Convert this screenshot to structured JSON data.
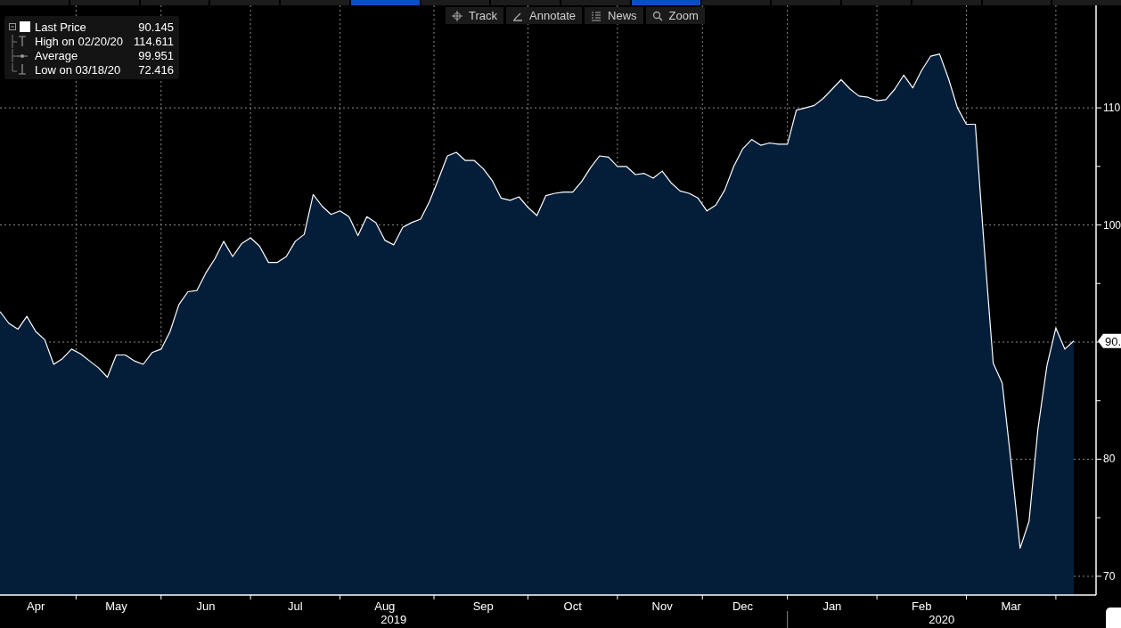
{
  "top_tabs": [
    {
      "selected": false
    },
    {
      "selected": false
    },
    {
      "selected": false
    },
    {
      "selected": false
    },
    {
      "selected": false
    },
    {
      "selected": true
    },
    {
      "selected": false
    },
    {
      "selected": false
    },
    {
      "selected": false
    },
    {
      "selected": true
    },
    {
      "selected": false
    },
    {
      "selected": false
    },
    {
      "selected": false
    },
    {
      "selected": false
    },
    {
      "selected": false
    },
    {
      "selected": false
    }
  ],
  "toolbar": [
    {
      "label": "Track",
      "kind": "track"
    },
    {
      "label": "Annotate",
      "kind": "annotate"
    },
    {
      "label": "News",
      "kind": "news"
    },
    {
      "label": "Zoom",
      "kind": "zoom"
    }
  ],
  "legend": {
    "items": [
      {
        "kind": "last",
        "value": "90.145"
      },
      {
        "kind": "high",
        "label": "High on 02/20/20",
        "value": "114.611"
      },
      {
        "kind": "average",
        "label": "Average",
        "value": "99.951"
      },
      {
        "kind": "low",
        "label": "Low on 03/18/20",
        "value": "72.416"
      }
    ]
  },
  "chart": {
    "chart_data": {
      "type": "area",
      "ylim": [
        68.4,
        118.6
      ],
      "yticks": [
        70,
        80,
        100,
        110
      ],
      "grid": true,
      "categories": [
        null,
        null,
        null,
        null,
        "Apr",
        null,
        null,
        null,
        null,
        null,
        null,
        null,
        null,
        "May",
        null,
        null,
        null,
        null,
        null,
        null,
        null,
        null,
        null,
        "Jun",
        null,
        null,
        null,
        null,
        null,
        null,
        null,
        null,
        null,
        "Jul",
        null,
        null,
        null,
        null,
        null,
        null,
        null,
        null,
        null,
        "Aug",
        null,
        null,
        null,
        null,
        null,
        null,
        null,
        null,
        null,
        null,
        "Sep",
        null,
        null,
        null,
        null,
        null,
        null,
        null,
        null,
        null,
        "Oct",
        null,
        null,
        null,
        null,
        null,
        null,
        null,
        null,
        null,
        "Nov",
        null,
        null,
        null,
        null,
        null,
        null,
        null,
        null,
        "Dec",
        null,
        null,
        null,
        null,
        null,
        null,
        null,
        null,
        null,
        "Jan",
        null,
        null,
        null,
        null,
        null,
        null,
        null,
        null,
        null,
        "Feb",
        null,
        null,
        null,
        null,
        null,
        null,
        null,
        null,
        null,
        "Mar",
        null,
        null,
        null,
        null,
        null,
        null,
        null
      ],
      "series": [
        {
          "name": "Last Price",
          "color": "#041e3a",
          "values": [
            92.6,
            91.6,
            91.1,
            92.2,
            90.9,
            90.2,
            88.1,
            88.6,
            89.4,
            89.0,
            88.4,
            87.8,
            87.0,
            88.9,
            88.9,
            88.4,
            88.1,
            89.1,
            89.4,
            90.9,
            93.2,
            94.3,
            94.4,
            95.9,
            97.1,
            98.6,
            97.3,
            98.4,
            98.9,
            98.2,
            96.8,
            96.8,
            97.3,
            98.6,
            99.2,
            102.6,
            101.6,
            100.9,
            101.2,
            100.7,
            99.1,
            100.7,
            100.2,
            98.7,
            98.3,
            99.8,
            100.2,
            100.5,
            102.0,
            103.9,
            105.9,
            106.2,
            105.5,
            105.5,
            104.8,
            103.8,
            102.3,
            102.1,
            102.4,
            101.5,
            100.8,
            102.5,
            102.7,
            102.8,
            102.8,
            103.7,
            104.9,
            105.9,
            105.8,
            105.0,
            105.0,
            104.3,
            104.4,
            104.0,
            104.6,
            103.6,
            102.9,
            102.7,
            102.3,
            101.2,
            101.7,
            103.0,
            105.0,
            106.5,
            107.3,
            106.8,
            107.0,
            106.9,
            106.9,
            109.8,
            110.0,
            110.2,
            110.8,
            111.6,
            112.4,
            111.6,
            111.0,
            110.9,
            110.6,
            110.7,
            111.6,
            112.8,
            111.7,
            113.2,
            114.4,
            114.6,
            112.5,
            110.0,
            108.6,
            108.6,
            98.0,
            88.2,
            86.5,
            79.7,
            72.4,
            74.7,
            82.6,
            88.0,
            91.2,
            89.4,
            90.1
          ]
        }
      ]
    },
    "last_price_tag": "90.",
    "years": [
      "2019",
      "2020"
    ]
  }
}
